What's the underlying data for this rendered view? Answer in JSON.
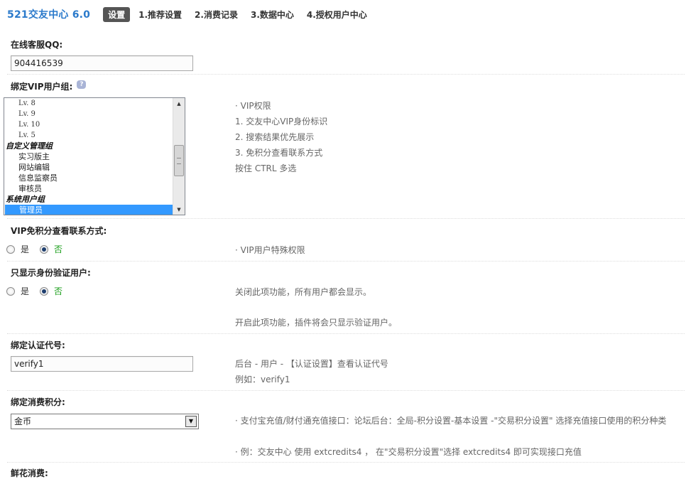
{
  "header": {
    "app_title": "521交友中心 6.0",
    "tabs": [
      {
        "label": "设置"
      },
      {
        "label": "1.推荐设置"
      },
      {
        "label": "2.消费记录"
      },
      {
        "label": "3.数据中心"
      },
      {
        "label": "4.授权用户中心"
      }
    ]
  },
  "qq": {
    "label": "在线客服QQ:",
    "value": "904416539"
  },
  "vip_group": {
    "label": "绑定VIP用户组:",
    "options": [
      {
        "text": "Lv. 8",
        "kind": "lv"
      },
      {
        "text": "Lv. 9",
        "kind": "lv"
      },
      {
        "text": "Lv. 10",
        "kind": "lv"
      },
      {
        "text": "Lv. 5",
        "kind": "lv"
      },
      {
        "text": "自定义管理组",
        "kind": "group"
      },
      {
        "text": "实习版主",
        "kind": "item"
      },
      {
        "text": "网站编辑",
        "kind": "item"
      },
      {
        "text": "信息监察员",
        "kind": "item"
      },
      {
        "text": "审核员",
        "kind": "item"
      },
      {
        "text": "系统用户组",
        "kind": "group"
      },
      {
        "text": "管理员",
        "kind": "item",
        "selected": true
      }
    ],
    "desc": [
      "· VIP权限",
      "1. 交友中心VIP身份标识",
      "2. 搜索结果优先展示",
      "3. 免积分查看联系方式",
      "按住 CTRL 多选"
    ]
  },
  "vip_free": {
    "label": "VIP免积分查看联系方式:",
    "yes": "是",
    "no": "否",
    "desc": "· VIP用户特殊权限"
  },
  "verified_only": {
    "label": "只显示身份验证用户:",
    "yes": "是",
    "no": "否",
    "desc1": "关闭此项功能，所有用户都会显示。",
    "desc2": "开启此项功能，插件将会只显示验证用户。"
  },
  "verify_code": {
    "label": "绑定认证代号:",
    "value": "verify1",
    "desc1": "后台 - 用户 - 【认证设置】查看认证代号",
    "desc2": "例如：verify1"
  },
  "credits": {
    "label": "绑定消费积分:",
    "value": "金币",
    "desc1": "· 支付宝充值/财付通充值接口：论坛后台：全局-积分设置-基本设置 -\"交易积分设置\" 选择充值接口使用的积分种类",
    "desc2": "· 例：交友中心 使用 extcredits4 ， 在\"交易积分设置\"选择 extcredits4 即可实现接口充值"
  },
  "flower": {
    "label": "鲜花消费:"
  },
  "icons": {
    "help": "help-icon",
    "scroll_up": "scroll-up-arrow-icon",
    "scroll_down": "scroll-down-arrow-icon",
    "select_arrow": "chevron-down-icon"
  },
  "colors": {
    "title": "#2b7acb",
    "active_tab_bg": "#555555",
    "selected_option": "#3399ff",
    "radio_no_label": "#1a9e1a"
  }
}
